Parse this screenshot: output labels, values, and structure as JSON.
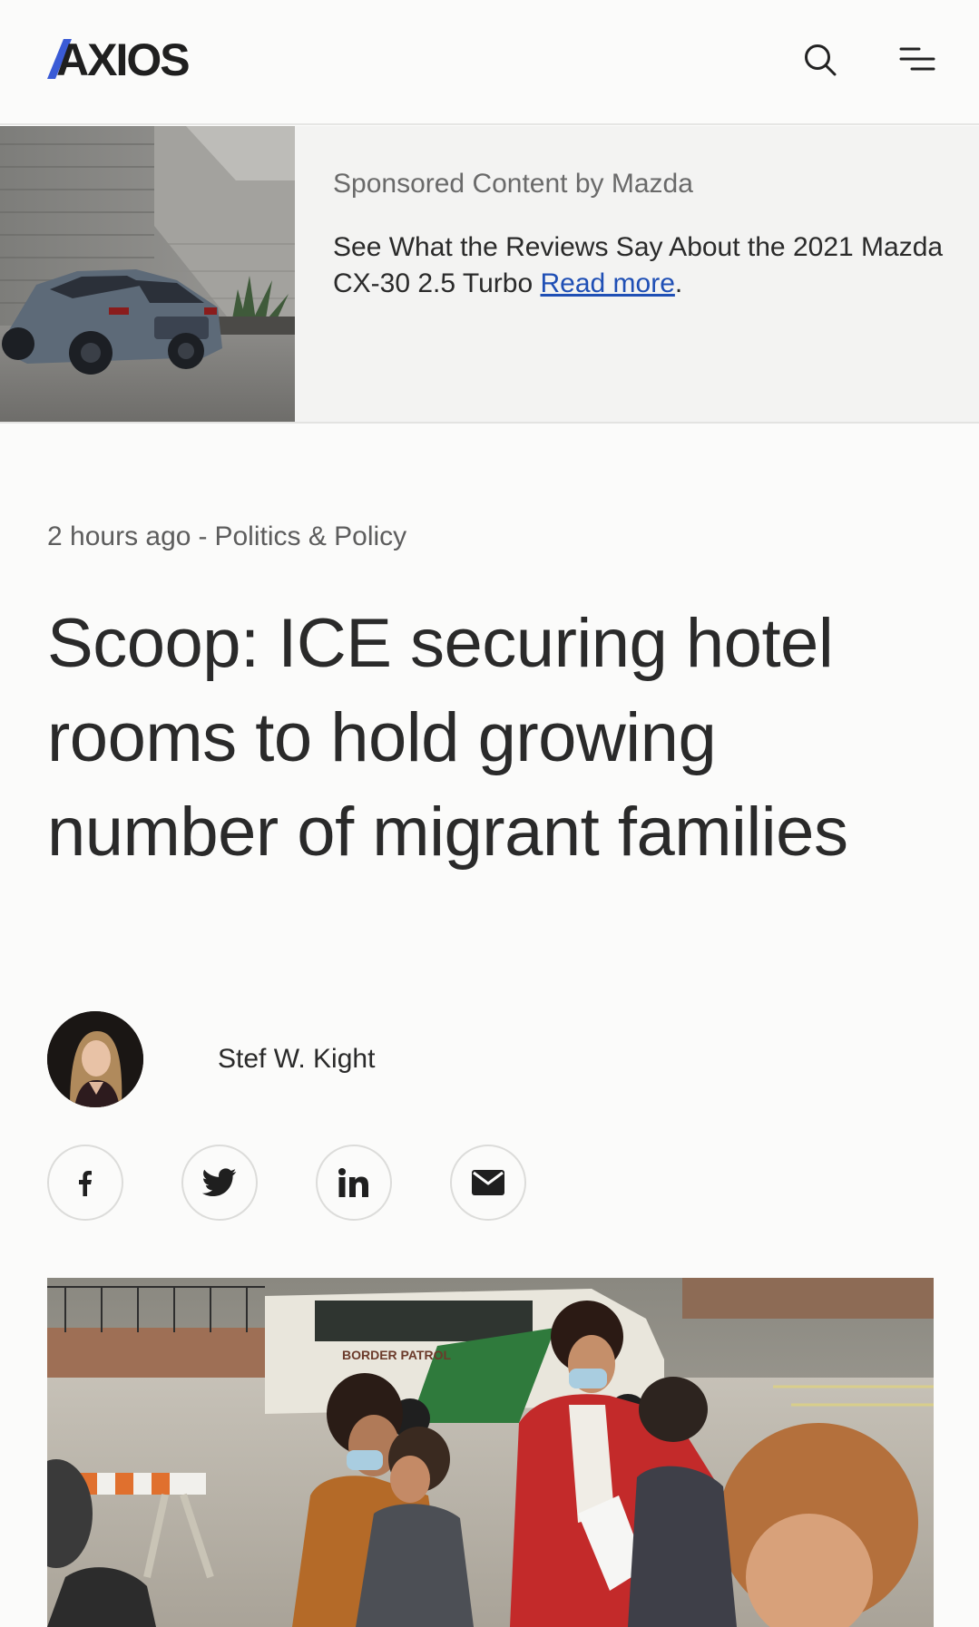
{
  "header": {
    "logo_text": "AXIOS",
    "search_icon": "search-icon",
    "menu_icon": "menu-icon"
  },
  "sponsored": {
    "label": "Sponsored Content by Mazda",
    "body": "See What the Reviews Say About the 2021 Mazda CX-30 2.5 Turbo",
    "link_text": "Read more",
    "trailing": "."
  },
  "article": {
    "time": "2 hours ago",
    "separator": "-",
    "category": "Politics & Policy",
    "headline": "Scoop: ICE securing hotel rooms to hold growing number of migrant families",
    "author": "Stef W. Kight",
    "lead_image_van_text": "BORDER PATROL"
  },
  "share": [
    {
      "name": "facebook",
      "icon": "facebook-icon"
    },
    {
      "name": "twitter",
      "icon": "twitter-icon"
    },
    {
      "name": "linkedin",
      "icon": "linkedin-icon"
    },
    {
      "name": "email",
      "icon": "email-icon"
    }
  ],
  "colors": {
    "logo_accent": "#3a5bd6",
    "link": "#1f4fb5",
    "text": "#2a2a2a",
    "muted": "#5d5d5d",
    "background": "#fbfbfa"
  }
}
